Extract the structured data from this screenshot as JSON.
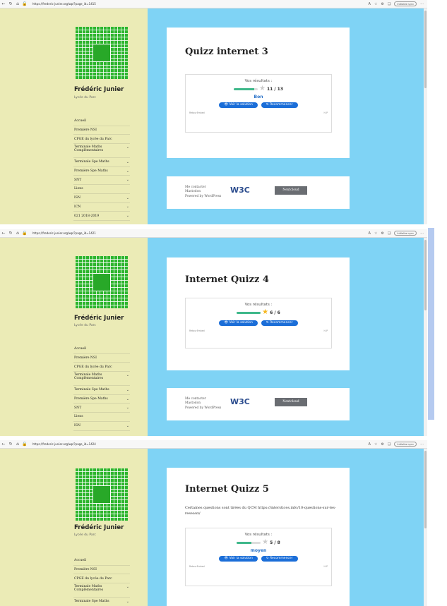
{
  "colors": {
    "sidebar": "#ebebb6",
    "page_bg": "#7fd3f5",
    "button": "#1b6ed8",
    "bar_fill": "#3eb88a",
    "score_link": "#2871c8",
    "star_full": "#f6b71f",
    "star_empty": "#cccccc"
  },
  "browser": {
    "nav_icons": [
      "back-icon",
      "refresh-icon",
      "home-icon",
      "lock-icon"
    ],
    "right_icons": [
      "read-aloud-icon",
      "favorite-icon",
      "extensions-icon",
      "collections-icon",
      "profile-icon"
    ],
    "sync_label": "Initialize sync",
    "more": "···"
  },
  "site": {
    "title": "Frédéric Junier",
    "description": "Lycée du Parc"
  },
  "menu": [
    {
      "label": "Accueil",
      "sub": false
    },
    {
      "label": "Première NSI",
      "sub": false
    },
    {
      "label": "CPGE du lycée du Parc",
      "sub": false
    },
    {
      "label": "Terminale Maths Complémentaires",
      "sub": true
    },
    {
      "label": "Terminale Spe Maths",
      "sub": true
    },
    {
      "label": "Première Spe Maths",
      "sub": true
    },
    {
      "label": "SNT",
      "sub": true
    },
    {
      "label": "Liens",
      "sub": false
    },
    {
      "label": "ISN",
      "sub": true
    },
    {
      "label": "ICN",
      "sub": true
    },
    {
      "label": "021 2018-2019",
      "sub": true
    }
  ],
  "quiz_ui": {
    "results_label": "Vos résultats :",
    "solution_btn": "Voir la solution",
    "restart_btn": "Recommencer",
    "foot_left": "Retour",
    "foot_mid": "Embed",
    "foot_right": "H-P"
  },
  "footer": {
    "links": [
      "Me contacter",
      "Mastodon",
      "Powered by WordPress"
    ],
    "w3c": "W3C",
    "nextcloud": "Nextcloud"
  },
  "shots": [
    {
      "url": "https://frederic-junier.org/wp/?page_id=1415",
      "title": "Quizz internet 3",
      "desc": "",
      "score": "11 / 13",
      "fraction": 0.846,
      "star_full": false,
      "comment": "Bon"
    },
    {
      "url": "https://frederic-junier.org/wp/?page_id=1421",
      "title": "Internet Quizz 4",
      "desc": "",
      "score": "6 / 6",
      "fraction": 1.0,
      "star_full": true,
      "comment": ""
    },
    {
      "url": "https://frederic-junier.org/wp/?page_id=1424",
      "title": "Internet Quizz 5",
      "desc": "Certaines questions sont tirées du QCM https://interstices.info/10-questions-sur-les-reseaux/",
      "score": "5 / 8",
      "fraction": 0.625,
      "star_full": false,
      "comment": "moyen"
    }
  ]
}
